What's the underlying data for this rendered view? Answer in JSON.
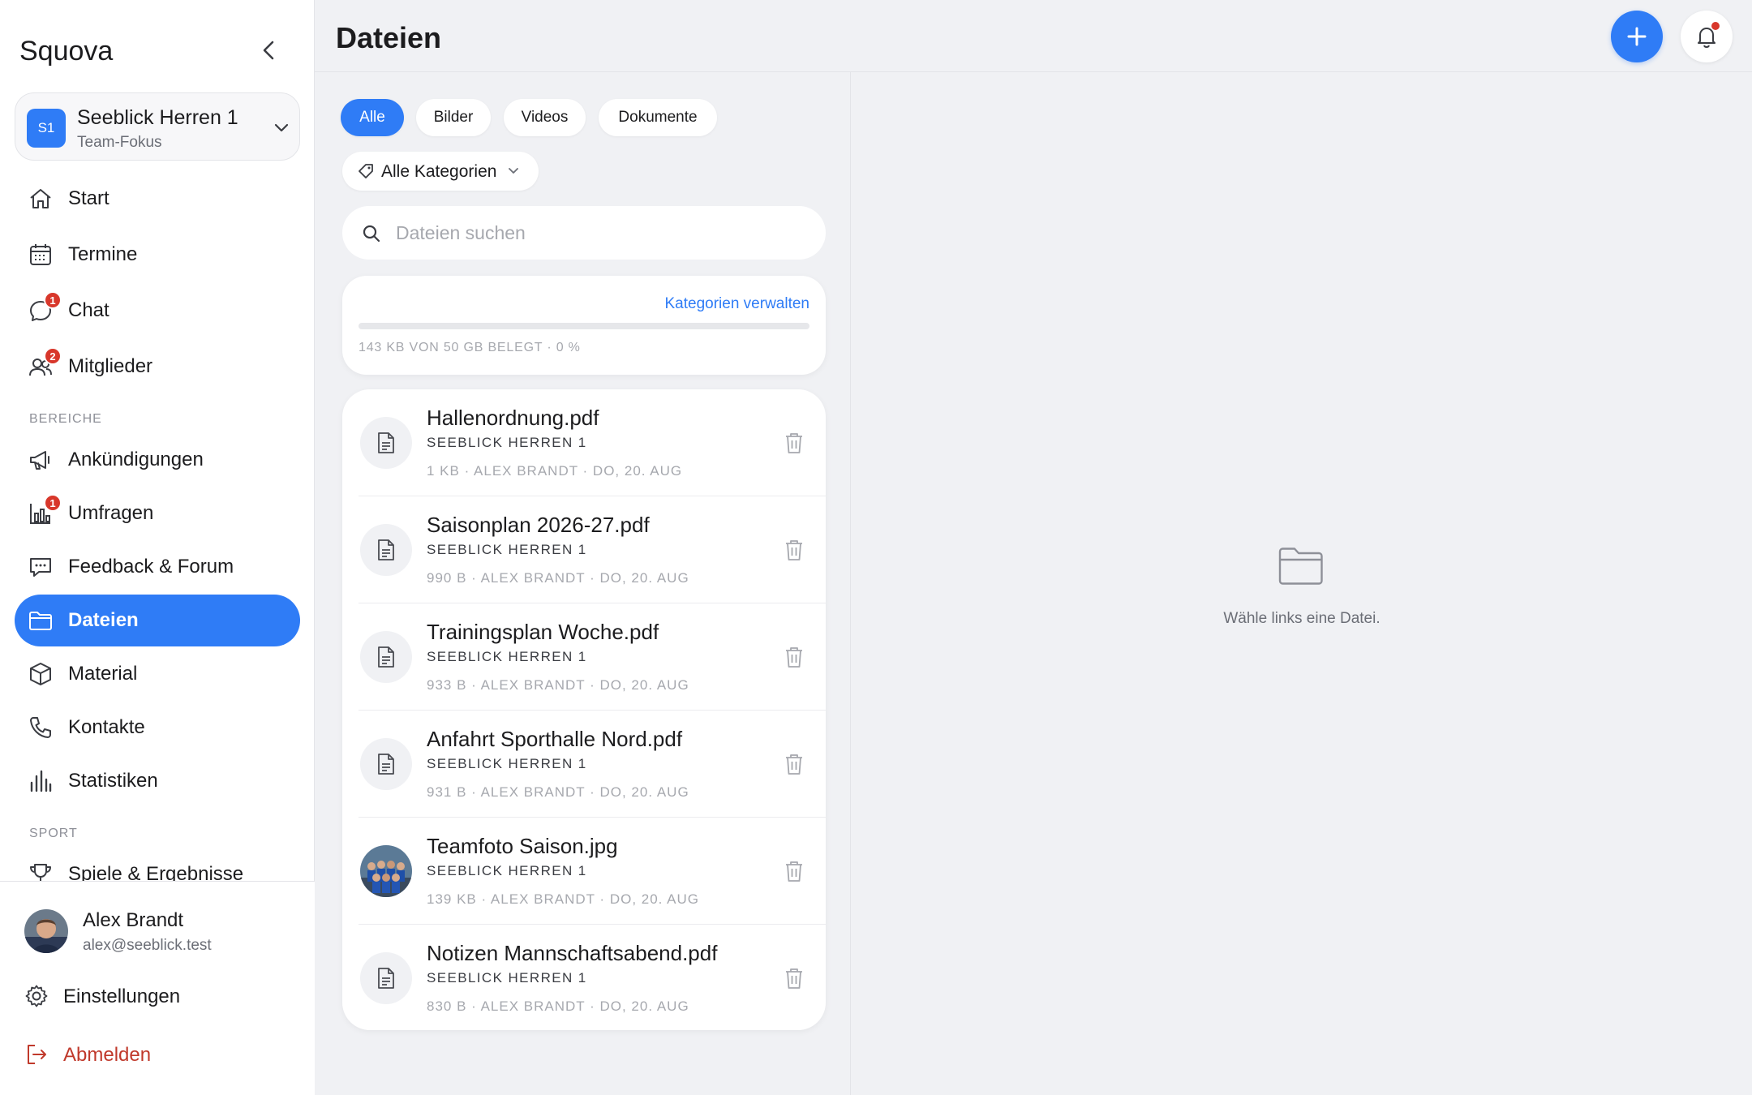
{
  "app": {
    "brand": "Squova"
  },
  "team": {
    "initials": "S1",
    "name": "Seeblick Herren 1",
    "subtitle": "Team-Fokus"
  },
  "nav": {
    "items": [
      {
        "label": "Start",
        "icon": "home-icon",
        "badge": null
      },
      {
        "label": "Termine",
        "icon": "calendar-icon",
        "badge": null
      },
      {
        "label": "Chat",
        "icon": "chat-icon",
        "badge": "1"
      },
      {
        "label": "Mitglieder",
        "icon": "members-icon",
        "badge": "2"
      }
    ],
    "section_areas": "BEREICHE",
    "area_items": [
      {
        "label": "Ankündigungen",
        "icon": "megaphone-icon",
        "badge": null
      },
      {
        "label": "Umfragen",
        "icon": "poll-icon",
        "badge": "1"
      },
      {
        "label": "Feedback & Forum",
        "icon": "forum-icon",
        "badge": null
      },
      {
        "label": "Dateien",
        "icon": "folder-icon",
        "badge": null,
        "active": true
      },
      {
        "label": "Material",
        "icon": "box-icon",
        "badge": null
      },
      {
        "label": "Kontakte",
        "icon": "phone-icon",
        "badge": null
      },
      {
        "label": "Statistiken",
        "icon": "stats-icon",
        "badge": null
      }
    ],
    "section_sport": "SPORT",
    "sport_items": [
      {
        "label": "Spiele & Ergebnisse",
        "icon": "trophy-icon",
        "badge": null
      }
    ]
  },
  "user": {
    "name": "Alex Brandt",
    "email": "alex@seeblick.test"
  },
  "footer": {
    "settings": "Einstellungen",
    "logout": "Abmelden"
  },
  "header": {
    "title": "Dateien"
  },
  "filters": {
    "chips": [
      "Alle",
      "Bilder",
      "Videos",
      "Dokumente"
    ],
    "active_chip": "Alle",
    "category": "Alle Kategorien"
  },
  "search": {
    "placeholder": "Dateien suchen",
    "value": ""
  },
  "storage": {
    "manage_link": "Kategorien verwalten",
    "summary": "143 KB VON 50 GB BELEGT · 0 %",
    "used_fraction": 0.0
  },
  "files": [
    {
      "name": "Hallenordnung.pdf",
      "team": "SEEBLICK HERREN 1",
      "meta": "1 KB · ALEX BRANDT · DO, 20. AUG",
      "kind": "document"
    },
    {
      "name": "Saisonplan 2026-27.pdf",
      "team": "SEEBLICK HERREN 1",
      "meta": "990 B · ALEX BRANDT · DO, 20. AUG",
      "kind": "document"
    },
    {
      "name": "Trainingsplan Woche.pdf",
      "team": "SEEBLICK HERREN 1",
      "meta": "933 B · ALEX BRANDT · DO, 20. AUG",
      "kind": "document"
    },
    {
      "name": "Anfahrt Sporthalle Nord.pdf",
      "team": "SEEBLICK HERREN 1",
      "meta": "931 B · ALEX BRANDT · DO, 20. AUG",
      "kind": "document"
    },
    {
      "name": "Teamfoto Saison.jpg",
      "team": "SEEBLICK HERREN 1",
      "meta": "139 KB · ALEX BRANDT · DO, 20. AUG",
      "kind": "image"
    },
    {
      "name": "Notizen Mannschaftsabend.pdf",
      "team": "SEEBLICK HERREN 1",
      "meta": "830 B · ALEX BRANDT · DO, 20. AUG",
      "kind": "document"
    }
  ],
  "detail": {
    "empty_text": "Wähle links eine Datei."
  },
  "colors": {
    "accent": "#2f7cf6",
    "badge": "#d8372b",
    "logout": "#c0392b",
    "background": "#f0f1f4"
  }
}
